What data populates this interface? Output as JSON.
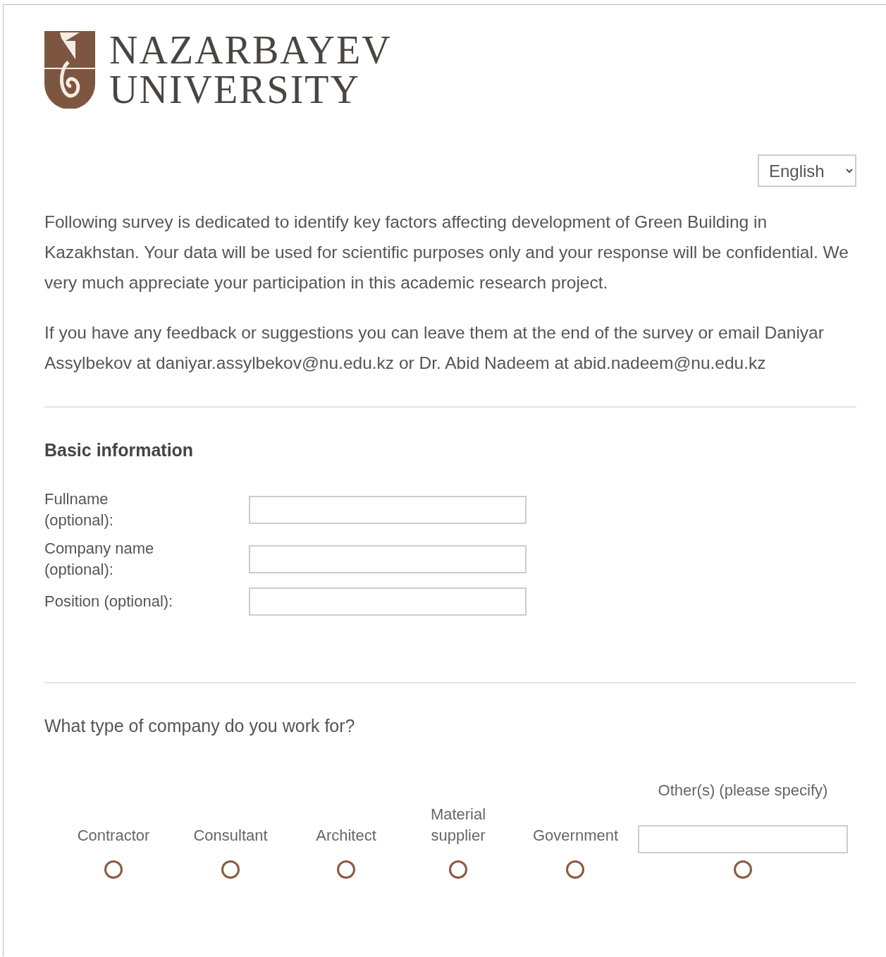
{
  "logo": {
    "line_1": "NAZARBAYEV",
    "line_2": "UNIVERSITY"
  },
  "language_select": {
    "value": "English"
  },
  "intro": [
    "Following survey is dedicated to identify key factors affecting development of Green Building in Kazakhstan. Your data will be used for scientific purposes only and your response will be confidential. We very much appreciate your participation in this academic research project.",
    "If you have any feedback or suggestions you can leave them at the end of the survey or email Daniyar Assylbekov at daniyar.assylbekov@nu.edu.kz or Dr. Abid Nadeem at abid.nadeem@nu.edu.kz"
  ],
  "basic_info": {
    "title": "Basic information",
    "fields": [
      {
        "label": "Fullname (optional):"
      },
      {
        "label": "Company name (optional):"
      },
      {
        "label": "Position (optional):"
      }
    ]
  },
  "question": {
    "text": "What type of company do you work for?",
    "options": [
      {
        "kind": "radio",
        "label": "Contractor",
        "selected": false
      },
      {
        "kind": "radio",
        "label": "Consultant",
        "selected": false
      },
      {
        "kind": "radio",
        "label": "Architect",
        "selected": false
      },
      {
        "kind": "radio",
        "label": "Material supplier",
        "selected": false
      },
      {
        "kind": "radio",
        "label": "Government",
        "selected": false
      },
      {
        "kind": "other",
        "label": "Other(s) (please specify)",
        "selected": false
      }
    ]
  }
}
